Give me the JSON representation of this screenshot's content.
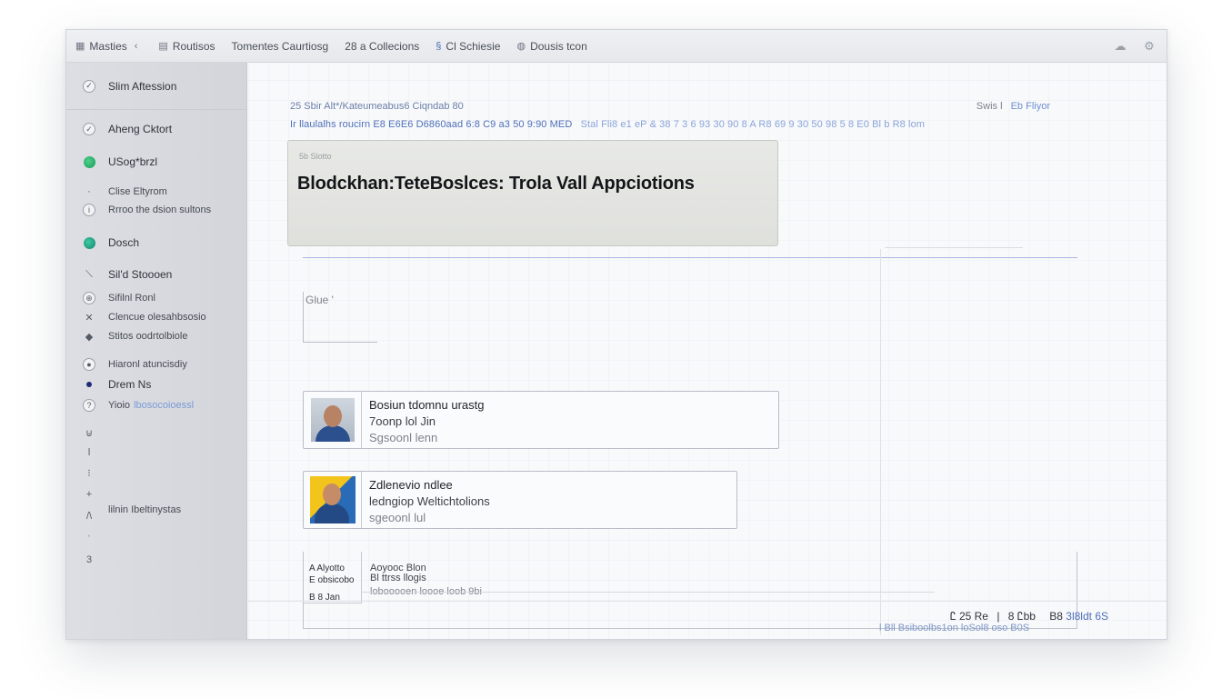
{
  "titlebar": {
    "items": [
      {
        "icon": "grid-icon",
        "label": "Masties"
      },
      {
        "icon": "document-icon",
        "label": "Routisos"
      },
      {
        "icon": "",
        "label": "Tomentes Caurtiosg"
      },
      {
        "icon": "",
        "label": "28 a Collecions"
      },
      {
        "icon": "link-icon",
        "label": "Cl Schiesie"
      },
      {
        "icon": "globe-icon",
        "label": "Dousis tcon"
      }
    ]
  },
  "sidebar": {
    "header": "Slim Aftession",
    "items": [
      {
        "label": "Aheng Cktort"
      },
      {
        "label": "USog*brzl"
      },
      {
        "label": "Clise Eltyrom"
      },
      {
        "label": "Rrroo the dsion sultons"
      },
      {
        "label": "Dosch"
      },
      {
        "label": "Sil'd Stoooen"
      },
      {
        "label": "Sifilnl Ronl"
      },
      {
        "label": "Clencue olesahbsosio"
      },
      {
        "label": "Stitos oodrtolbiole"
      },
      {
        "label": "Hiaronl atuncisdiy"
      },
      {
        "label": "Drem Ns"
      },
      {
        "label": "Yioio",
        "suffix": "lbosocoioessl"
      },
      {
        "label": "lilnin Ibeltinystas"
      }
    ]
  },
  "main": {
    "meta_left": "25 Sbir Alt*/Kateumeabus6 Ciqndab 80",
    "meta_right_a": "Swis l",
    "meta_right_b": "Eb Fliyor",
    "meta_line": "Ir llaulalhs roucirn E8 E6E6 D6860aad 6:8 C9 a3 50 9:90 MED",
    "meta_line_faint": "Stal Fli8 e1 eP & 38 7 3 6 93 30 90 8 A R8 69 9 30 50 98 5 8 E0 Bl b R8 lom",
    "title_card": {
      "tiny": "5b Slotto",
      "title": "Blodckhan:TeteBoslces: Trola Vall Appciotions"
    },
    "glue_label": "Glue '",
    "cards": [
      {
        "line1": "Bosiun tdomnu urastg",
        "line2": "7oonp lol Jin",
        "line3": "Sgsoonl lenn"
      },
      {
        "line1": "Zdlenevio ndlee",
        "line2": "ledngiop Weltichtolions",
        "line3": "sgeoonl lul"
      }
    ],
    "card3": {
      "left_line1": "A Alyotto",
      "left_line2": "E obsicobo",
      "left_line3": "B 8 Jan",
      "text1": "Aoyooc Blon",
      "text2": "Bl ttrss llogis",
      "text3": "lobooooen loooe loob 9bi"
    },
    "footer": {
      "part1": "Ꮭ 25 Re",
      "part2": "8 Ꮭbb",
      "part3": "B8",
      "part4": "3l8ldt 6S",
      "faint": "l Bll Bsiboolbs1on loSol8 oso B0S"
    }
  }
}
